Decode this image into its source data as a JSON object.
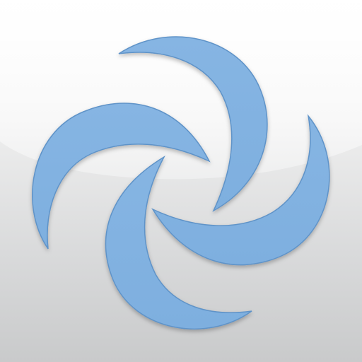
{
  "app_icon": {
    "logo": {
      "icon": "pinwheel-swirl-icon",
      "blade_count": 4,
      "blade_color": "#7eafdf",
      "blade_edge_color": "#5f93c8"
    },
    "background": {
      "gradient_top": "#fbfbfb",
      "gradient_bottom": "#c9cacb",
      "gloss_color": "#ffffff"
    }
  }
}
